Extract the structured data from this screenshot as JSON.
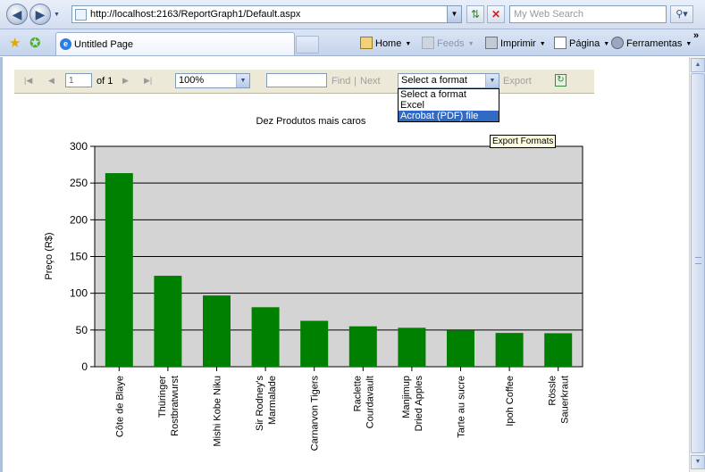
{
  "browser": {
    "url": "http://localhost:2163/ReportGraph1/Default.aspx",
    "search_placeholder": "My Web Search",
    "tab_title": "Untitled Page",
    "commands": {
      "home": "Home",
      "feeds": "Feeds",
      "print": "Imprimir",
      "page": "Página",
      "tools": "Ferramentas"
    }
  },
  "report_toolbar": {
    "page_number": "1",
    "page_total_label": "of 1",
    "zoom": "100%",
    "find_label": "Find",
    "separator": "|",
    "next_label": "Next",
    "format_selected": "Select a format",
    "export_label": "Export",
    "format_options": [
      "Select a format",
      "Excel",
      "Acrobat (PDF) file"
    ],
    "highlighted_option_index": 2,
    "tooltip": "Export Formats"
  },
  "chart_data": {
    "type": "bar",
    "title": "Dez Produtos mais caros",
    "ylabel": "Preço (R$)",
    "xlabel": "",
    "ylim": [
      0,
      300
    ],
    "yticks": [
      "0",
      "50",
      "100",
      "150",
      "200",
      "250",
      "300"
    ],
    "categories": [
      [
        "Côte de Blaye"
      ],
      [
        "Thüringer",
        "Rostbratwurst"
      ],
      [
        "Mishi Kobe Niku"
      ],
      [
        "Sir Rodney's",
        "Marmalade"
      ],
      [
        "Carnarvon Tigers"
      ],
      [
        "Raclette",
        "Courdavault"
      ],
      [
        "Manjimup",
        "Dried Apples"
      ],
      [
        "Tarte au sucre"
      ],
      [
        "Ipoh Coffee"
      ],
      [
        "Rössle",
        "Sauerkraut"
      ]
    ],
    "values": [
      263.5,
      123.79,
      97,
      81,
      62.5,
      55,
      53,
      49.3,
      46,
      45.6
    ],
    "bar_color": "#008000",
    "plot_background": "#d4d4d4",
    "grid": true
  }
}
